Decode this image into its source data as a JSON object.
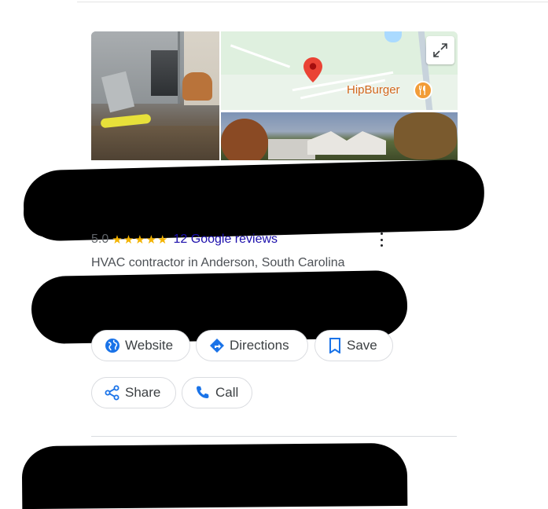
{
  "map": {
    "place_label": "HipBurger"
  },
  "business": {
    "rating_value": "5.0",
    "stars": "★★★★★",
    "reviews_label": "12 Google reviews",
    "category": "HVAC contractor in Anderson, South Carolina"
  },
  "actions": {
    "website_label": "Website",
    "directions_label": "Directions",
    "save_label": "Save",
    "share_label": "Share",
    "call_label": "Call"
  },
  "colors": {
    "link": "#1a0dab",
    "star": "#f4b400",
    "icon_blue": "#1a73e8",
    "pin_red": "#ea4335",
    "place_orange": "#d0661b"
  },
  "icons": {
    "website": "globe-icon",
    "directions": "directions-icon",
    "save": "bookmark-icon",
    "share": "share-icon",
    "call": "phone-icon",
    "expand": "expand-icon",
    "pin": "map-pin-icon",
    "food": "restaurant-icon",
    "more": "more-vert-icon"
  }
}
